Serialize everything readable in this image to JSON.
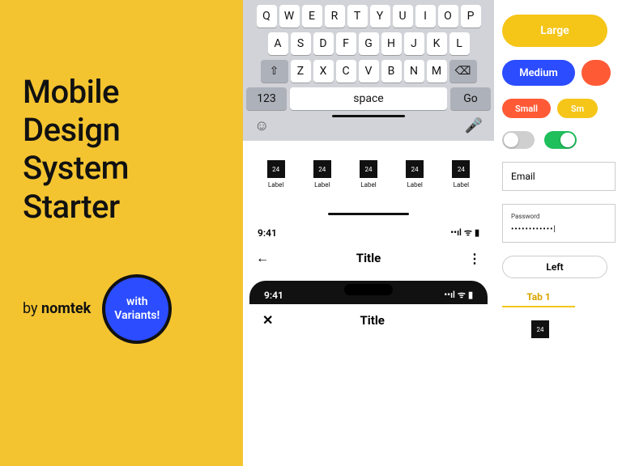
{
  "hero": {
    "title_lines": [
      "Mobile",
      "Design",
      "System",
      "Starter"
    ],
    "by_prefix": "by ",
    "by_brand": "nomtek",
    "badge_line1": "with",
    "badge_line2": "Variants!"
  },
  "keyboard": {
    "row1": [
      "Q",
      "W",
      "E",
      "R",
      "T",
      "Y",
      "U",
      "I",
      "O",
      "P"
    ],
    "row2": [
      "A",
      "S",
      "D",
      "F",
      "G",
      "H",
      "J",
      "K",
      "L"
    ],
    "row3_mid": [
      "Z",
      "X",
      "C",
      "V",
      "B",
      "N",
      "M"
    ],
    "shift": "⇧",
    "backspace": "⌫",
    "num_key": "123",
    "space_key": "space",
    "go_key": "Go",
    "emoji": "☺",
    "mic": "🎤"
  },
  "icon_labels": {
    "icon_text": "24",
    "label": "Label",
    "count": 5
  },
  "statusbar": {
    "time": "9:41",
    "signal": "••ıl",
    "wifi": "ᯤ",
    "battery": "▮"
  },
  "navbar_light": {
    "back": "←",
    "title": "Title",
    "more": "⋮"
  },
  "navbar_dark": {
    "close": "✕",
    "title": "Title"
  },
  "buttons": {
    "large": "Large",
    "medium": "Medium",
    "small": "Small",
    "small2": "Sm"
  },
  "fields": {
    "email": "Email",
    "password_label": "Password",
    "password_value": "••••••••••••|"
  },
  "chips": {
    "left": "Left"
  },
  "tabs": {
    "tab1": "Tab 1"
  },
  "mini_icon": "24"
}
